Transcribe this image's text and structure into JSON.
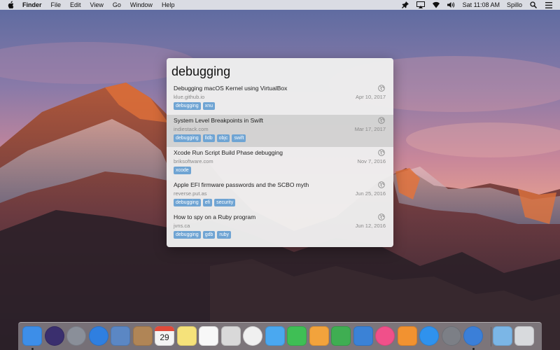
{
  "menubar": {
    "app_name": "Finder",
    "items": [
      "File",
      "Edit",
      "View",
      "Go",
      "Window",
      "Help"
    ],
    "clock": "Sat 11:08 AM",
    "app_status": "Spillo",
    "icons": [
      "pin-icon",
      "airplay-icon",
      "wifi-icon",
      "volume-icon",
      "search-icon",
      "list-icon"
    ]
  },
  "panel": {
    "title": "debugging",
    "results": [
      {
        "title": "Debugging macOS Kernel using VirtualBox",
        "domain": "klue.github.io",
        "date": "Apr 10, 2017",
        "tags": [
          "debugging",
          "xnu"
        ],
        "selected": false
      },
      {
        "title": "System Level Breakpoints in Swift",
        "domain": "indiestack.com",
        "date": "Mar 17, 2017",
        "tags": [
          "debugging",
          "lldb",
          "objc",
          "swift"
        ],
        "selected": true
      },
      {
        "title": "Xcode Run Script Build Phase debugging",
        "domain": "briksoftware.com",
        "date": "Nov 7, 2016",
        "tags": [
          "xcode"
        ],
        "selected": false
      },
      {
        "title": "Apple EFI firmware passwords and the SCBO myth",
        "domain": "reverse.put.as",
        "date": "Jun 25, 2016",
        "tags": [
          "debugging",
          "efi",
          "security"
        ],
        "selected": false
      },
      {
        "title": "How to spy on a Ruby program",
        "domain": "jvns.ca",
        "date": "Jun 12, 2016",
        "tags": [
          "debugging",
          "gdb",
          "ruby"
        ],
        "selected": false
      }
    ]
  },
  "dock": {
    "apps": [
      {
        "icon": "finder-icon",
        "color": "#3d8ee8",
        "running": true
      },
      {
        "icon": "siri-icon",
        "color": "#3a2f6e",
        "running": false
      },
      {
        "icon": "launchpad-icon",
        "color": "#8a8f99",
        "running": false
      },
      {
        "icon": "safari-icon",
        "color": "#2f7fe0",
        "running": false
      },
      {
        "icon": "preview-icon",
        "color": "#5b87c4",
        "running": false
      },
      {
        "icon": "contacts-icon",
        "color": "#b08556",
        "running": false
      },
      {
        "icon": "calendar-icon",
        "color": "#f4f4f4",
        "running": false
      },
      {
        "icon": "notes-icon",
        "color": "#f5e27a",
        "running": false
      },
      {
        "icon": "reminders-icon",
        "color": "#f8f8f8",
        "running": false
      },
      {
        "icon": "photo-booth-icon",
        "color": "#d9d9d9",
        "running": false
      },
      {
        "icon": "photos-icon",
        "color": "#f0f0f0",
        "running": false
      },
      {
        "icon": "messages-icon",
        "color": "#4aa8f0",
        "running": false
      },
      {
        "icon": "facetime-icon",
        "color": "#3fbf55",
        "running": false
      },
      {
        "icon": "pages-icon",
        "color": "#f2a33c",
        "running": false
      },
      {
        "icon": "numbers-icon",
        "color": "#3fae52",
        "running": false
      },
      {
        "icon": "keynote-icon",
        "color": "#3b82d6",
        "running": false
      },
      {
        "icon": "itunes-icon",
        "color": "#f0508a",
        "running": false
      },
      {
        "icon": "ibooks-icon",
        "color": "#f29230",
        "running": false
      },
      {
        "icon": "app-store-icon",
        "color": "#2f92ee",
        "running": false
      },
      {
        "icon": "system-preferences-icon",
        "color": "#7c7f86",
        "running": false
      },
      {
        "icon": "spillo-icon",
        "color": "#3b7fd8",
        "running": true
      },
      {
        "icon": "downloads-folder-icon",
        "color": "#7bb6e6",
        "running": false
      },
      {
        "icon": "trash-icon",
        "color": "#d8dadd",
        "running": false
      }
    ],
    "calendar_day": "29"
  }
}
